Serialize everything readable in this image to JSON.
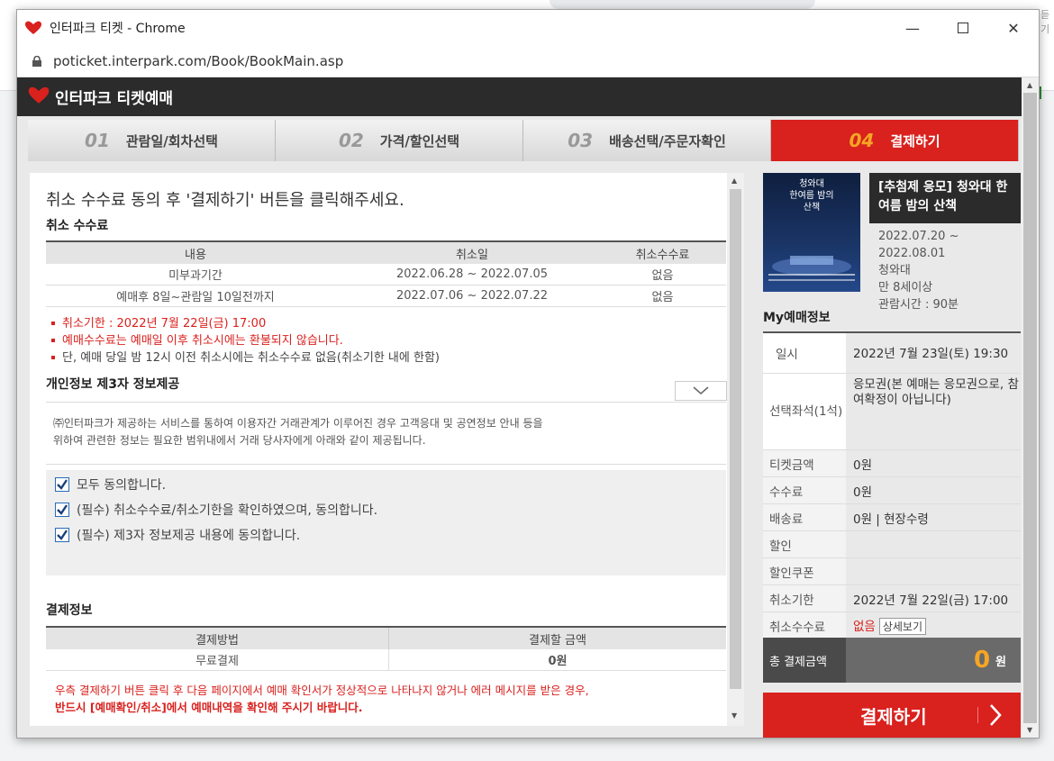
{
  "browser": {
    "window_title": "인터파크 티켓 - Chrome",
    "url": "poticket.interpark.com/Book/BookMain.asp",
    "background_text": "듣기"
  },
  "app": {
    "brand": "인터파크 티켓예매",
    "steps": [
      {
        "num": "01",
        "label": "관람일/회차선택",
        "active": false
      },
      {
        "num": "02",
        "label": "가격/할인선택",
        "active": false
      },
      {
        "num": "03",
        "label": "배송선택/주문자확인",
        "active": false
      },
      {
        "num": "04",
        "label": "결제하기",
        "active": true
      }
    ]
  },
  "main": {
    "heading": "취소 수수료 동의 후 '결제하기' 버튼을 클릭해주세요.",
    "cancel_fee": {
      "title": "취소 수수료",
      "headers": [
        "내용",
        "취소일",
        "취소수수료"
      ],
      "rows": [
        [
          "미부과기간",
          "2022.06.28 ~ 2022.07.05",
          "없음"
        ],
        [
          "예매후 8일~관람일 10일전까지",
          "2022.07.06 ~ 2022.07.22",
          "없음"
        ]
      ]
    },
    "notes": [
      "취소기한 : 2022년 7월 22일(금) 17:00",
      "예매수수료는 예매일 이후 취소시에는 환불되지 않습니다.",
      "단, 예매 당일 밤 12시 이전 취소시에는 취소수수료 없음(취소기한 내에 한함)"
    ],
    "privacy": {
      "title": "개인정보 제3자 정보제공",
      "text_line1": "㈜인터파크가 제공하는 서비스를 통하여 이용자간 거래관계가 이루어진 경우 고객응대 및 공연정보 안내 등을",
      "text_line2": "위하여 관련한 정보는 필요한 범위내에서 거래 당사자에게 아래와 같이 제공됩니다."
    },
    "agreements": [
      "모두 동의합니다.",
      "(필수) 취소수수료/취소기한을 확인하였으며, 동의합니다.",
      "(필수) 제3자 정보제공 내용에 동의합니다."
    ],
    "payment_info": {
      "title": "결제정보",
      "headers": [
        "결제방법",
        "결제할 금액"
      ],
      "method": "무료결제",
      "amount": "0원"
    },
    "payment_note_line1": "우측 결제하기 버튼 클릭 후 다음 페이지에서 예매 확인서가 정상적으로 나타나지 않거나 에러 메시지를 받은 경우,",
    "payment_note_line2": "반드시 [예매확인/취소]에서 예매내역을 확인해 주시기 바랍니다."
  },
  "sidebar": {
    "poster_text": "청와대\n한여름 밤의\n산책",
    "event_title": "[추첨제 응모] 청와대 한여름 밤의 산책",
    "event_dates_line1": "2022.07.20 ~",
    "event_dates_line2": "2022.08.01",
    "venue": "청와대",
    "age": "만 8세이상",
    "runtime": "관람시간 : 90분",
    "my_title": "My예매정보",
    "rows": {
      "date_label": "일시",
      "date_value": "2022년 7월 23일(토) 19:30",
      "seat_label": "선택좌석(1석)",
      "seat_value": "응모권(본 예매는 응모권으로, 참여확정이 아닙니다)",
      "ticket_label": "티켓금액",
      "ticket_value": "0원",
      "fee_label": "수수료",
      "fee_value": "0원",
      "delivery_label": "배송료",
      "delivery_value": "0원 | 현장수령",
      "discount_label": "할인",
      "coupon_label": "할인쿠폰",
      "cancel_deadline_label": "취소기한",
      "cancel_deadline_value": "2022년 7월 22일(금) 17:00",
      "cancel_fee_label": "취소수수료",
      "cancel_fee_value": "없음",
      "detail_button": "상세보기"
    },
    "total_label": "총 결제금액",
    "total_amount": "0",
    "total_unit": "원",
    "pay_button": "결제하기"
  },
  "colors": {
    "accent": "#d9211e",
    "dark": "#2b2b2b",
    "highlight": "#f6a623"
  }
}
